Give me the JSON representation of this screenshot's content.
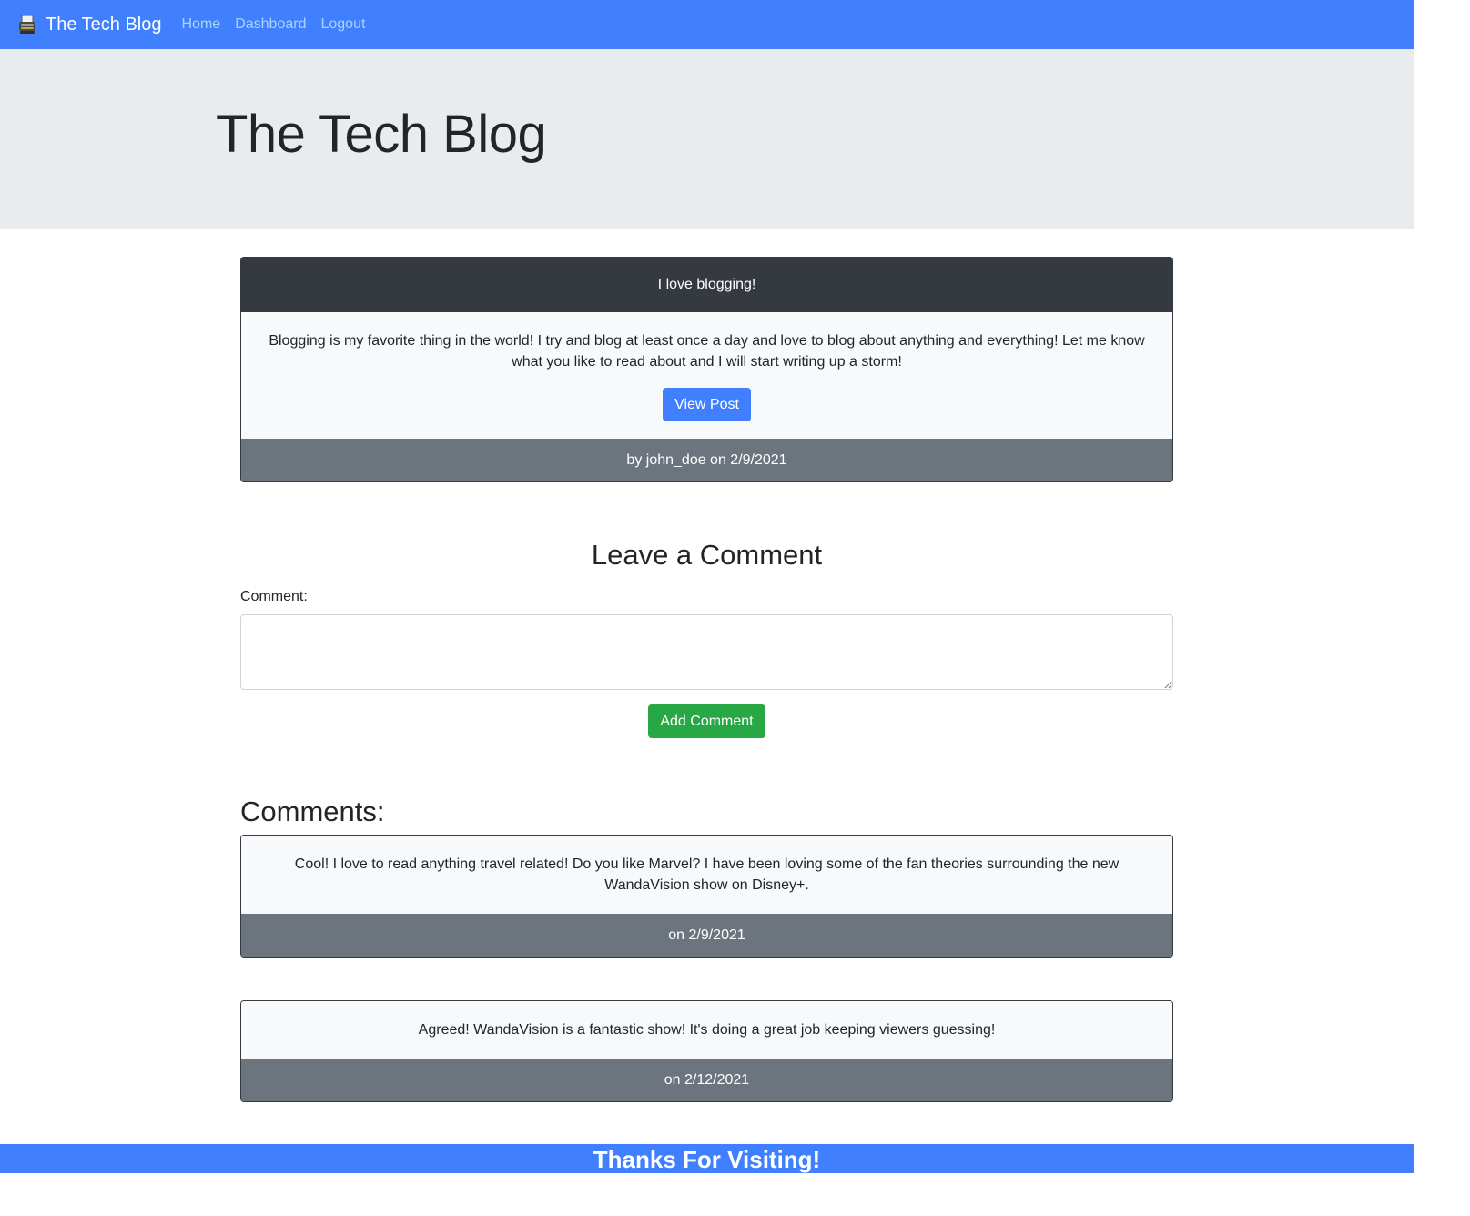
{
  "nav": {
    "brand": "The Tech Blog",
    "brand_icon": "typewriter-icon",
    "links": [
      "Home",
      "Dashboard",
      "Logout"
    ]
  },
  "jumbotron": {
    "title": "The Tech Blog"
  },
  "post": {
    "title": "I love blogging!",
    "content": "Blogging is my favorite thing in the world! I try and blog at least once a day and love to blog about anything and everything! Let me know what you like to read about and I will start writing up a storm!",
    "button_label": "View Post",
    "byline": "by john_doe on 2/9/2021"
  },
  "comment_form": {
    "title": "Leave a Comment",
    "label": "Comment:",
    "value": "",
    "submit_label": "Add Comment"
  },
  "comments": {
    "title": "Comments:",
    "items": [
      {
        "text": "Cool! I love to read anything travel related! Do you like Marvel? I have been loving some of the fan theories surrounding the new WandaVision show on Disney+.",
        "date": "on 2/9/2021"
      },
      {
        "text": "Agreed! WandaVision is a fantastic show! It's doing a great job keeping viewers guessing!",
        "date": "on 2/12/2021"
      }
    ]
  },
  "footer": {
    "text": "Thanks For Visiting!"
  },
  "colors": {
    "primary": "#4080ff",
    "success": "#28a745",
    "dark": "#343a40",
    "secondary": "#6c757d",
    "light": "#f8f9fa",
    "jumbotron": "#e9ecef"
  }
}
